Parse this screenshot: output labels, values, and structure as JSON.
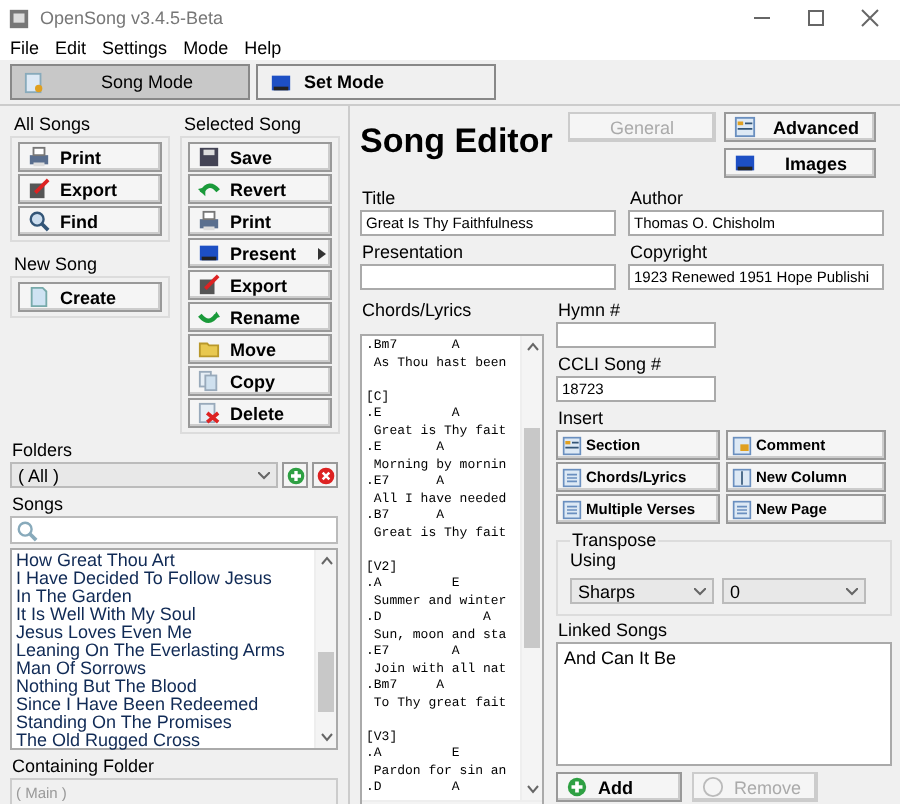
{
  "window": {
    "title": "OpenSong v3.4.5-Beta"
  },
  "menu": [
    "File",
    "Edit",
    "Settings",
    "Mode",
    "Help"
  ],
  "modes": [
    {
      "label": "Song Mode",
      "kind": "music",
      "selected": true
    },
    {
      "label": "Set Mode",
      "kind": "screen",
      "selected": false
    }
  ],
  "all_songs": {
    "title": "All Songs",
    "buttons": [
      {
        "label": "Print",
        "kind": "printer"
      },
      {
        "label": "Export",
        "kind": "export"
      },
      {
        "label": "Find",
        "kind": "search"
      }
    ]
  },
  "new_song": {
    "title": "New Song",
    "buttons": [
      {
        "label": "Create",
        "kind": "document"
      }
    ]
  },
  "selected_song": {
    "title": "Selected Song",
    "buttons": [
      {
        "label": "Save",
        "kind": "disk",
        "submenu": false
      },
      {
        "label": "Revert",
        "kind": "undo",
        "submenu": false
      },
      {
        "label": "Print",
        "kind": "printer",
        "submenu": false
      },
      {
        "label": "Present",
        "kind": "screen",
        "submenu": true
      },
      {
        "label": "Export",
        "kind": "export",
        "submenu": false
      },
      {
        "label": "Rename",
        "kind": "redo",
        "submenu": false
      },
      {
        "label": "Move",
        "kind": "folder",
        "submenu": false
      },
      {
        "label": "Copy",
        "kind": "copy",
        "submenu": false
      },
      {
        "label": "Delete",
        "kind": "delete",
        "submenu": false
      }
    ]
  },
  "folders": {
    "label": "Folders",
    "value": "( All )"
  },
  "songs": {
    "label": "Songs",
    "items": [
      "How Great Thou Art",
      "I Have Decided To Follow Jesus",
      "In The Garden",
      "It Is Well With My Soul",
      "Jesus Loves Even Me",
      "Leaning On The Everlasting Arms",
      "Man Of Sorrows",
      "Nothing But The Blood",
      "Since I Have Been Redeemed",
      "Standing On The Promises",
      "The Old Rugged Cross"
    ]
  },
  "containing_folder": {
    "label": "Containing Folder",
    "value": "( Main )",
    "disabled": true
  },
  "editor": {
    "heading": "Song Editor",
    "tabs": [
      {
        "label": "General",
        "kind": "blank",
        "disabled": true
      },
      {
        "label": "Advanced",
        "kind": "list",
        "disabled": false
      },
      {
        "label": "Images",
        "kind": "screen",
        "disabled": false
      }
    ],
    "fields": [
      {
        "label": "Title",
        "value": "Great Is Thy Faithfulness"
      },
      {
        "label": "Author",
        "value": "Thomas O. Chisholm"
      },
      {
        "label": "Presentation"
      },
      {
        "label": "Copyright",
        "value": "1923 Renewed 1951 Hope Publishi"
      }
    ],
    "chords_lyrics": {
      "label": "Chords/Lyrics",
      "blocks": [
        {
          "lines": [
            ".Bm7       A",
            " As Thou hast been"
          ]
        },
        {
          "lines": [
            "[C]",
            ".E         A",
            " Great is Thy fait",
            ".E       A",
            " Morning by mornin",
            ".E7      A",
            " All I have needed",
            ".B7      A",
            " Great is Thy fait"
          ]
        },
        {
          "lines": [
            "[V2]",
            ".A         E",
            " Summer and winter",
            ".D             A",
            " Sun, moon and sta",
            ".E7        A",
            " Join with all nat",
            ".Bm7     A",
            " To Thy great fait"
          ]
        },
        {
          "lines": [
            "[V3]",
            ".A         E",
            " Pardon for sin an",
            ".D         A"
          ]
        }
      ]
    },
    "hymn": {
      "label": "Hymn #"
    },
    "ccli": {
      "label": "CCLI Song #",
      "value": "18723"
    },
    "insert": {
      "label": "Insert",
      "buttons": [
        {
          "label": "Section",
          "kind": "list"
        },
        {
          "label": "Comment",
          "kind": "comment"
        },
        {
          "label": "Chords/Lyrics",
          "kind": "page"
        },
        {
          "label": "New Column",
          "kind": "column"
        },
        {
          "label": "Multiple Verses",
          "kind": "page"
        },
        {
          "label": "New Page",
          "kind": "page"
        }
      ]
    },
    "transpose": {
      "title": "Transpose",
      "using_label": "Using",
      "notation": "Sharps",
      "key": "0"
    },
    "linked_songs": {
      "label": "Linked Songs",
      "items": [
        "And Can It Be"
      ],
      "buttons": [
        {
          "label": "Add",
          "kind": "add",
          "disabled": false
        },
        {
          "label": "Remove",
          "kind": "remove",
          "disabled": true
        }
      ]
    }
  }
}
